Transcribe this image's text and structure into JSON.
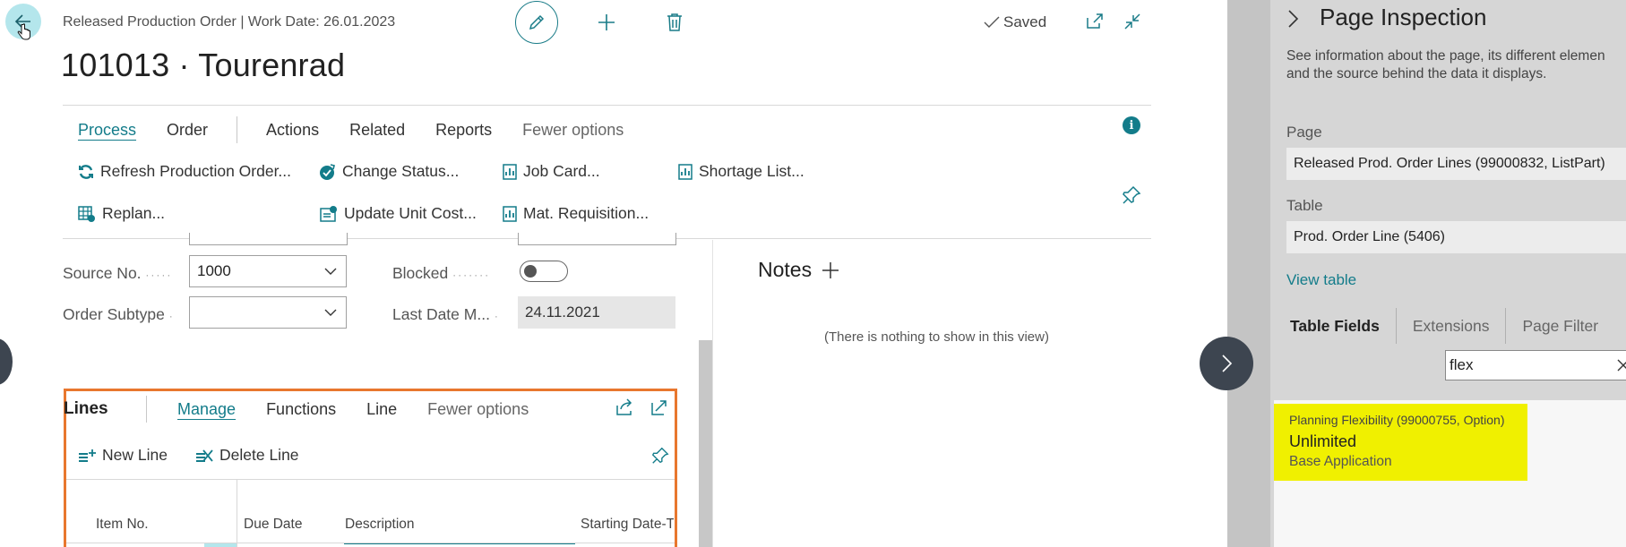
{
  "header": {
    "subtitle": "Released Production Order | Work Date: 26.01.2023",
    "title": "101013 · Tourenrad",
    "saved_label": "Saved"
  },
  "action_tabs": [
    {
      "label": "Process",
      "active": true
    },
    {
      "label": "Order"
    },
    {
      "label": "Actions"
    },
    {
      "label": "Related"
    },
    {
      "label": "Reports"
    },
    {
      "label": "Fewer options"
    }
  ],
  "actions": {
    "refresh": "Refresh Production Order...",
    "change_status": "Change Status...",
    "job_card": "Job Card...",
    "shortage_list": "Shortage List...",
    "replan": "Replan...",
    "update_unit_cost": "Update Unit Cost...",
    "mat_requisition": "Mat. Requisition..."
  },
  "fields": {
    "source_no_label": "Source No.",
    "source_no_value": "1000",
    "order_subtype_label": "Order Subtype",
    "order_subtype_value": "",
    "blocked_label": "Blocked",
    "blocked_value": false,
    "last_date_label": "Last Date M...",
    "last_date_value": "24.11.2021"
  },
  "notes": {
    "title": "Notes",
    "empty_text": "(There is nothing to show in this view)"
  },
  "lines": {
    "title": "Lines",
    "tabs": [
      "Manage",
      "Functions",
      "Line",
      "Fewer options"
    ],
    "new_line": "New Line",
    "delete_line": "Delete Line",
    "columns": [
      "Item No.",
      "Due Date",
      "Description",
      "Starting Date-Ti"
    ]
  },
  "inspector": {
    "title": "Page Inspection",
    "description_line1": "See information about the page, its different elemen",
    "description_line2": "and the source behind the data it displays.",
    "page_label": "Page",
    "page_value": "Released Prod. Order Lines (99000832, ListPart)",
    "table_label": "Table",
    "table_value": "Prod. Order Line (5406)",
    "view_table": "View table",
    "tabs": [
      "Table Fields",
      "Extensions",
      "Page Filter"
    ],
    "search_value": "flex",
    "result": {
      "field": "Planning Flexibility (99000755, Option)",
      "value": "Unlimited",
      "source": "Base Application"
    }
  },
  "colors": {
    "accent": "#137c8a",
    "highlight": "#f0f000",
    "focus_border": "#e8772e"
  }
}
